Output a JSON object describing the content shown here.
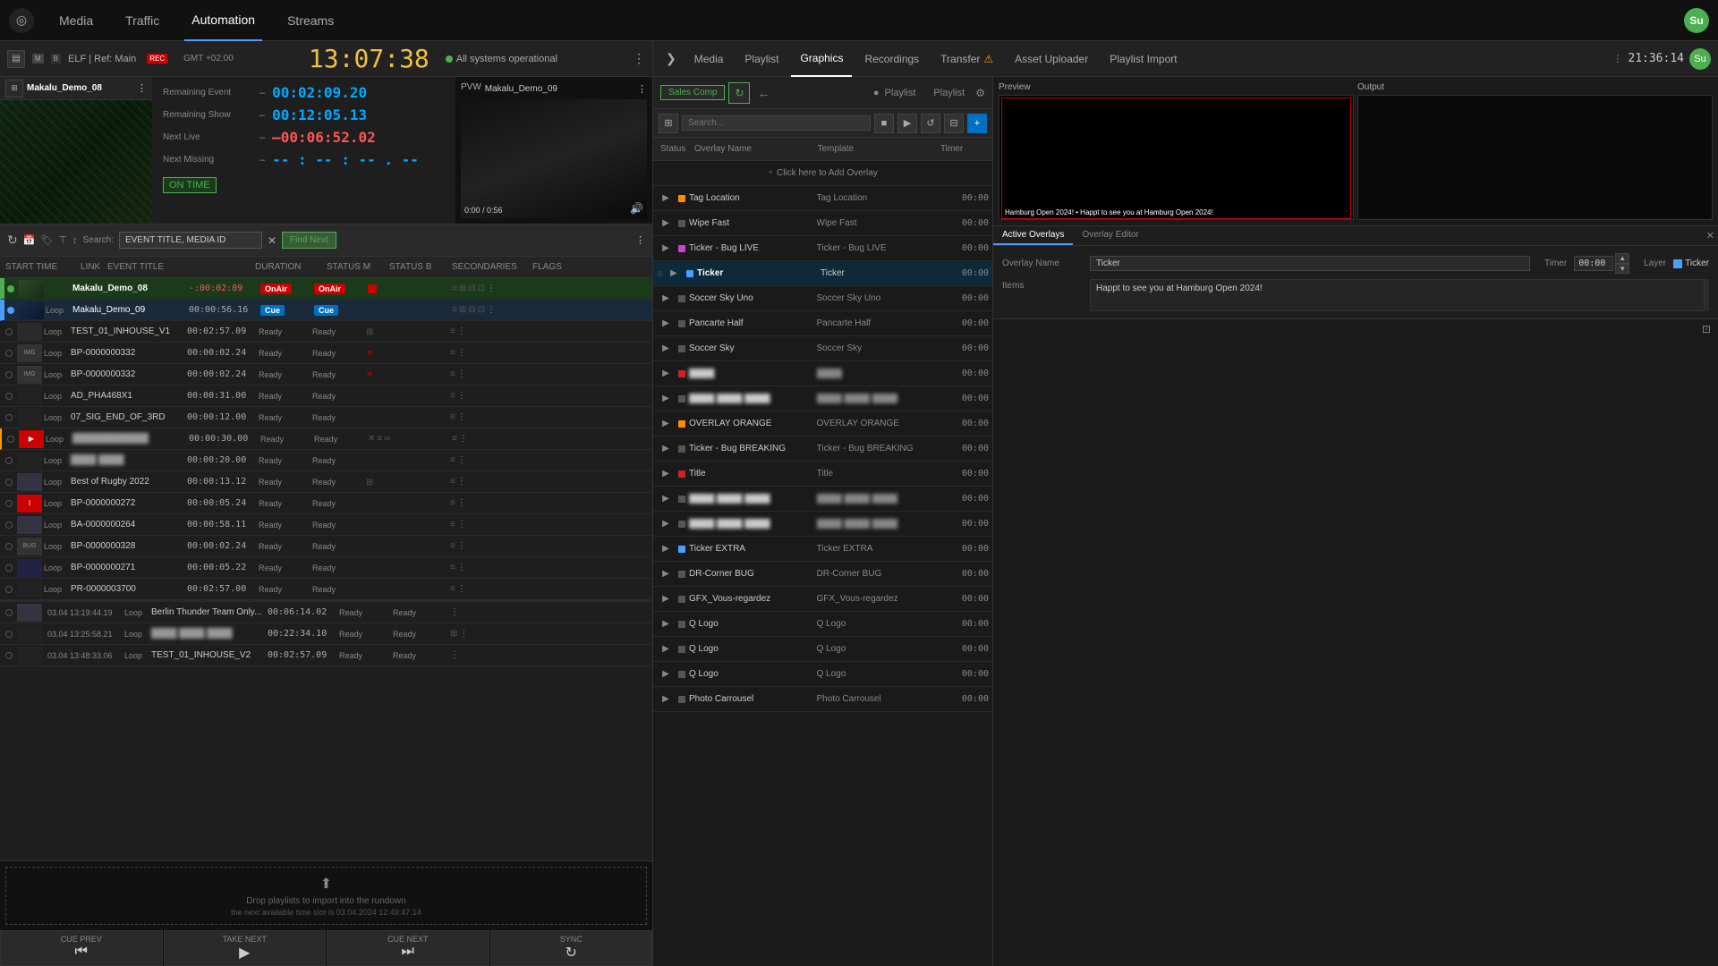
{
  "app": {
    "logo": "◎",
    "nav_items": [
      "Media",
      "Traffic",
      "Automation",
      "Streams"
    ],
    "active_nav": "Automation",
    "user_initials": "Su",
    "time_right": "21:36:14"
  },
  "left_panel": {
    "channel_name": "ELF | Ref: Main",
    "gmt_label": "GMT +02:00",
    "clock": "13:07:38",
    "status_text": "All systems operational",
    "m_badge": "M",
    "b_badge": "B",
    "rec_badge": "REC",
    "video_title": "Makalu_Demo_08",
    "countdown": {
      "remaining_event_label": "Remaining Event",
      "remaining_event": "00:02:09.20",
      "remaining_show_label": "Remaining Show",
      "remaining_show": "00:12:05.13",
      "next_live_label": "Next Live",
      "next_live": "–00:06:52.02",
      "next_missing_label": "Next Missing",
      "next_missing": "-- : -- : -- . --",
      "on_time_label": "ON TIME"
    },
    "pvw": {
      "label": "PVW",
      "title": "Makalu_Demo_09",
      "time": "0:00 / 0:56"
    },
    "search_placeholder": "EVENT TITLE, MEDIA ID",
    "find_next_label": "Find Next",
    "columns": [
      "START TIME",
      "LINK",
      "EVENT TITLE",
      "DURATION",
      "STATUS M",
      "STATUS B",
      "SECONDARIES",
      "FLAGS"
    ],
    "rows": [
      {
        "type": "Loop",
        "dot": "green",
        "color": "green",
        "name": "Makalu_Demo_08",
        "duration": "-:00:02:09",
        "status_m": "OnAir",
        "status_b": "OnAir",
        "has_red": true,
        "flags": "icons"
      },
      {
        "type": "Loop",
        "dot": "blue",
        "color": "blue",
        "name": "Makalu_Demo_09",
        "duration": "00:00:56.16",
        "status_m": "Cue",
        "status_b": "Cue",
        "flags": "icons"
      },
      {
        "type": "Loop",
        "dot": "",
        "color": "",
        "name": "TEST_01_INHOUSE_V1",
        "duration": "00:02:57.09",
        "status_m": "Ready",
        "status_b": "Ready",
        "flags": "icons"
      },
      {
        "type": "Loop",
        "dot": "",
        "color": "",
        "name": "BP-0000000332",
        "duration": "00:00:02.24",
        "status_m": "Ready",
        "status_b": "Ready",
        "has_red_x": true,
        "flags": "icons"
      },
      {
        "type": "Loop",
        "dot": "",
        "color": "",
        "name": "BP-0000000332",
        "duration": "00:00:02.24",
        "status_m": "Ready",
        "status_b": "Ready",
        "has_red_x": true,
        "flags": "icons"
      },
      {
        "type": "Loop",
        "dot": "",
        "color": "",
        "name": "AD_PHA468X1",
        "duration": "00:00:31.00",
        "status_m": "Ready",
        "status_b": "Ready",
        "flags": "icons"
      },
      {
        "type": "Loop",
        "dot": "",
        "color": "",
        "name": "07_SIG_END_OF_3RD",
        "duration": "00:00:12.00",
        "status_m": "Ready",
        "status_b": "Ready",
        "flags": "icons"
      },
      {
        "type": "Loop",
        "dot": "",
        "color": "orange",
        "name": "████████████",
        "duration": "00:00:30.00",
        "status_m": "Ready",
        "status_b": "Ready",
        "has_special": true,
        "flags": "icons"
      },
      {
        "type": "Loop",
        "dot": "",
        "color": "",
        "name": "████ ████",
        "duration": "00:00:20.00",
        "status_m": "Ready",
        "status_b": "Ready",
        "flags": "icons"
      },
      {
        "type": "Loop",
        "dot": "",
        "color": "",
        "name": "Best of Rugby 2022",
        "duration": "00:00:13.12",
        "status_m": "Ready",
        "status_b": "Ready",
        "flags": "icons"
      },
      {
        "type": "Loop",
        "dot": "",
        "color": "",
        "name": "BP-0000000272",
        "duration": "00:00:05.24",
        "status_m": "Ready",
        "status_b": "Ready",
        "flags": "icons"
      },
      {
        "type": "Loop",
        "dot": "",
        "color": "",
        "name": "BA-0000000264",
        "duration": "00:00:58.11",
        "status_m": "Ready",
        "status_b": "Ready",
        "flags": "icons"
      },
      {
        "type": "Loop",
        "dot": "",
        "color": "",
        "name": "BP-0000000328",
        "duration": "00:00:02.24",
        "status_m": "Ready",
        "status_b": "Ready",
        "flags": "icons"
      },
      {
        "type": "Loop",
        "dot": "",
        "color": "",
        "name": "BP-0000000271",
        "duration": "00:00:05.22",
        "status_m": "Ready",
        "status_b": "Ready",
        "flags": "icons"
      },
      {
        "type": "Loop",
        "dot": "",
        "color": "",
        "name": "PR-0000003700",
        "duration": "00:02:57.00",
        "status_m": "Ready",
        "status_b": "Ready",
        "flags": "icons"
      },
      {
        "time": "03.04 13:19:44.19",
        "type": "Loop",
        "dot": "",
        "color": "",
        "name": "Berlin Thunder Team Only...",
        "duration": "00:06:14.02",
        "status_m": "Ready",
        "status_b": "Ready",
        "flags": "icons"
      },
      {
        "time": "03.04 13:25:58.21",
        "type": "Loop",
        "dot": "",
        "color": "",
        "name": "████ ████ ████",
        "duration": "00:22:34.10",
        "status_m": "Ready",
        "status_b": "Ready",
        "flags": "icons"
      },
      {
        "time": "03.04 13:48:33.06",
        "type": "Loop",
        "dot": "",
        "color": "",
        "name": "TEST_01_INHOUSE_V2",
        "duration": "00:02:57.09",
        "status_m": "Ready",
        "status_b": "Ready",
        "flags": "icons"
      }
    ],
    "cue_buttons": [
      {
        "label": "CUE PREV",
        "icon": "⏮"
      },
      {
        "label": "TAKE NEXT",
        "icon": "▶"
      },
      {
        "label": "CUE NEXT",
        "icon": "⏭"
      },
      {
        "label": "SYNC",
        "icon": "↻"
      }
    ],
    "drop_zone_text": "Drop playlists to import into the rundown",
    "drop_zone_sub": "the next available time slot is 03.04.2024 12:49:47.14"
  },
  "right_panel": {
    "nav_arrow": "❯",
    "nav_items": [
      "Media",
      "Playlist",
      "Graphics",
      "Recordings",
      "Transfer",
      "Asset Uploader",
      "Playlist Import"
    ],
    "active_nav": "Graphics",
    "transfer_warning": true,
    "time": "21:36:14",
    "graphics": {
      "sales_comp_label": "Sales Comp",
      "playlist_label": "Playlist",
      "search_placeholder": "Search...",
      "add_overlay_label": "Click here to Add Overlay",
      "overlays": [
        {
          "name": "Tag Location",
          "template": "Tag Location",
          "timer": "00:00",
          "color": "#ff8c00"
        },
        {
          "name": "Wipe Fast",
          "template": "Wipe Fast",
          "timer": "00:00",
          "color": ""
        },
        {
          "name": "Ticker - Bug LIVE",
          "template": "Ticker - Bug LIVE",
          "timer": "00:00",
          "color": "#cc44cc"
        },
        {
          "name": "Ticker",
          "template": "Ticker",
          "timer": "00:00",
          "color": "#4a9eff",
          "active": true
        },
        {
          "name": "Soccer Sky Uno",
          "template": "Soccer Sky Uno",
          "timer": "00:00",
          "color": ""
        },
        {
          "name": "Pancarte Half",
          "template": "Pancarte Half",
          "timer": "00:00",
          "color": ""
        },
        {
          "name": "Soccer Sky",
          "template": "Soccer Sky",
          "timer": "00:00",
          "color": ""
        },
        {
          "name": "████",
          "template": "████",
          "timer": "00:00",
          "color": "#cc2222",
          "blurred": true
        },
        {
          "name": "████ ████ ████",
          "template": "████ ████ ████",
          "timer": "00:00",
          "color": "",
          "blurred": true
        },
        {
          "name": "OVERLAY ORANGE",
          "template": "OVERLAY ORANGE",
          "timer": "00:00",
          "color": "#ff8c00"
        },
        {
          "name": "Ticker - Bug BREAKING",
          "template": "Ticker - Bug BREAKING",
          "timer": "00:00",
          "color": ""
        },
        {
          "name": "Title",
          "template": "Title",
          "timer": "00:00",
          "color": "#cc2222"
        },
        {
          "name": "████ ████ ████",
          "template": "████ ████ ████",
          "timer": "00:00",
          "color": "",
          "blurred": true
        },
        {
          "name": "████ ████ ████",
          "template": "████ ████ ████",
          "timer": "00:00",
          "color": "",
          "blurred": true
        },
        {
          "name": "Ticker EXTRA",
          "template": "Ticker EXTRA",
          "timer": "00:00",
          "color": "#4a9eff"
        },
        {
          "name": "DR-Corner BUG",
          "template": "DR-Corner BUG",
          "timer": "00:00",
          "color": ""
        },
        {
          "name": "GFX_Vous-regardez",
          "template": "GFX_Vous-regardez",
          "timer": "00:00",
          "color": ""
        },
        {
          "name": "Q Logo",
          "template": "Q Logo",
          "timer": "00:00",
          "color": ""
        },
        {
          "name": "Q Logo",
          "template": "Q Logo",
          "timer": "00:00",
          "color": ""
        },
        {
          "name": "Q Logo",
          "template": "Q Logo",
          "timer": "00:00",
          "color": ""
        },
        {
          "name": "Photo Carrousel",
          "template": "Photo Carrousel",
          "timer": "00:00",
          "color": ""
        }
      ],
      "preview_label": "Preview",
      "output_label": "Output",
      "preview_overlay_text": "Hamburg Open 2024! • Happt to see you at Hamburg Open 2024!",
      "active_overlays_tab": "Active Overlays",
      "overlay_editor_tab": "Overlay Editor",
      "editor": {
        "overlay_name_label": "Overlay Name",
        "overlay_name_val": "Ticker",
        "timer_label": "Timer",
        "timer_val": "00:00",
        "layer_label": "Layer",
        "layer_color": "#4a9eff",
        "layer_val": "Ticker",
        "items_label": "Items",
        "items_val": "Happt to see you at Hamburg Open 2024!"
      }
    }
  }
}
